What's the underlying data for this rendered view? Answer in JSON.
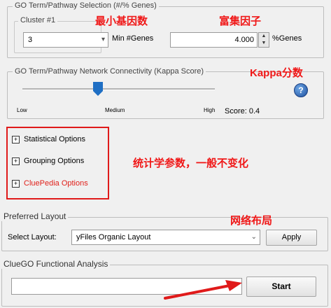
{
  "selection_panel": {
    "legend": "GO Term/Pathway Selection (#/% Genes)",
    "cluster_legend": "Cluster #1",
    "cluster_value": "3",
    "min_genes_label": "Min #Genes",
    "percent_value": "4.000",
    "percent_label": "%Genes"
  },
  "kappa_panel": {
    "legend": "GO Term/Pathway Network Connectivity (Kappa Score)",
    "low_label": "Low",
    "medium_label": "Medium",
    "high_label": "High",
    "score_text": "Score: 0.4",
    "help_glyph": "?",
    "slider_value": 0.4
  },
  "options": {
    "statistical": "Statistical Options",
    "grouping": "Grouping Options",
    "cluepedia": "CluePedia Options",
    "expand_glyph": "+",
    "cluepedia_color": "#e0201a"
  },
  "layout_panel": {
    "legend": "Preferred Layout",
    "select_label": "Select Layout:",
    "layout_value": "yFiles Organic Layout",
    "apply_label": "Apply"
  },
  "analysis_panel": {
    "legend": "ClueGO Functional Analysis",
    "start_label": "Start"
  },
  "annotations": {
    "min_genes": "最小基因数",
    "enrichment": "富集因子",
    "kappa": "Kappa分数",
    "stats": "统计学参数，一般不变化",
    "layout": "网络布局",
    "color": "#f01818"
  },
  "icons": {
    "dropdown": "chevron-down-icon",
    "help": "help-icon",
    "expand": "plus-box-icon"
  }
}
